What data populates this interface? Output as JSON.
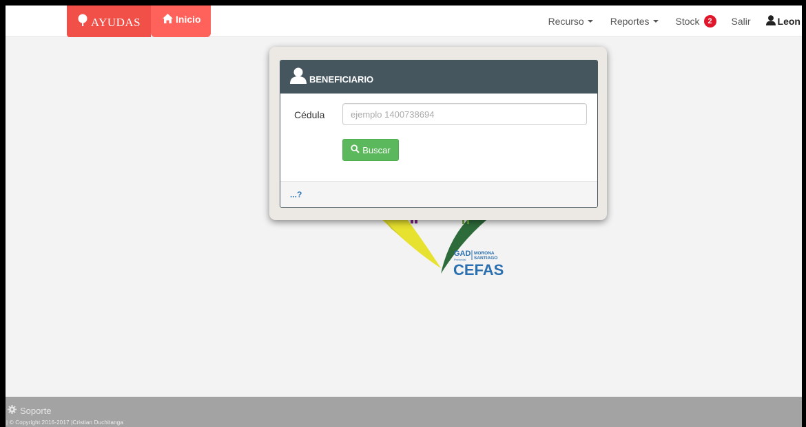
{
  "navbar": {
    "brand": "AYUDAS",
    "inicio": "Inicio",
    "links": {
      "recurso": "Recurso",
      "reportes": "Reportes",
      "stock": "Stock",
      "stock_count": "2",
      "salir": "Salir",
      "user": "Leon"
    }
  },
  "panel": {
    "title": "BENEFICIARIO",
    "cedula_label": "Cédula",
    "cedula_placeholder": "ejemplo 1400738694",
    "cedula_value": "",
    "buscar_label": "Buscar",
    "footer_link": "...?"
  },
  "logo": {
    "line1_left": "GAD",
    "line1_sub": "Provincial",
    "line1_right_top": "MORONA",
    "line1_right_bottom": "SANTIAGO",
    "line2": "CEFAS"
  },
  "footer": {
    "soporte": "Soporte",
    "copyright": "| © Copyright:2016-2017 |Cristian Duchitanga"
  },
  "colors": {
    "brand": "#f05048",
    "inicio": "#ff625a",
    "panel_header": "#46565f",
    "button": "#5cb85c",
    "badge": "#e0172b",
    "footer": "#a3a3a3",
    "link": "#2a6fb0"
  },
  "icons": {
    "brand": "tree-icon",
    "inicio": "home-icon",
    "panel": "user-icon",
    "buscar": "search-icon",
    "soporte": "gear-icon",
    "user": "user-icon"
  }
}
